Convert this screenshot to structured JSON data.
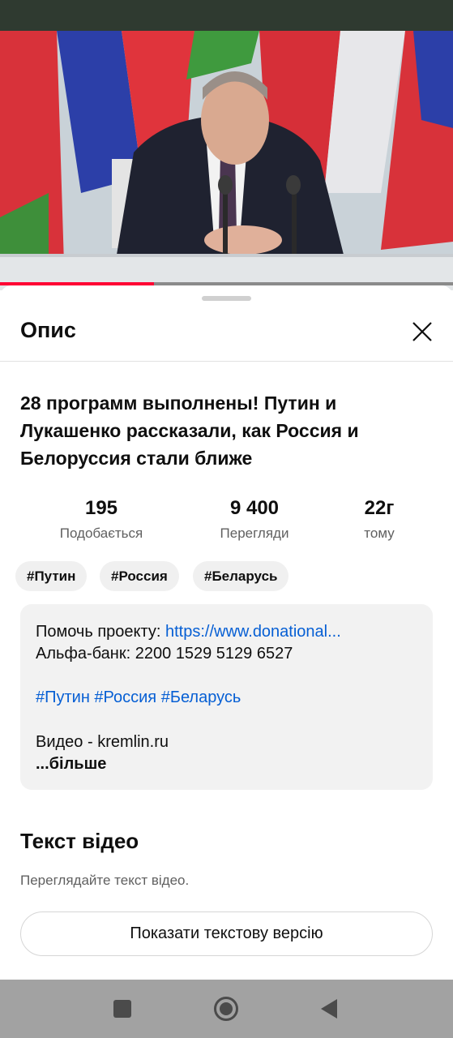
{
  "sheet": {
    "title": "Опис",
    "close_icon": "close-icon"
  },
  "video": {
    "progress": 0.34,
    "title": "28 программ выполнены! Путин и Лукашенко рассказали, как Россия и Белоруссия стали ближе"
  },
  "stats": [
    {
      "value": "195",
      "label": "Подобається"
    },
    {
      "value": "9 400",
      "label": "Перегляди"
    },
    {
      "value": "22г",
      "label": "тому"
    }
  ],
  "hashtags": [
    "#Путин",
    "#Россия",
    "#Беларусь"
  ],
  "description": {
    "support_label": "Помочь проекту: ",
    "support_link": "https://www.donational...",
    "bank_line": "Альфа-банк: 2200 1529 5129 6527",
    "tags_line": "#Путин #Россия #Беларусь",
    "source_line": "Видео - kremlin.ru",
    "more_label": "...більше"
  },
  "transcript": {
    "title": "Текст відео",
    "subtitle": "Переглядайте текст відео.",
    "button_label": "Показати текстову версію"
  },
  "nav": {
    "recents_icon": "square-icon",
    "home_icon": "circle-icon",
    "back_icon": "triangle-back-icon"
  }
}
